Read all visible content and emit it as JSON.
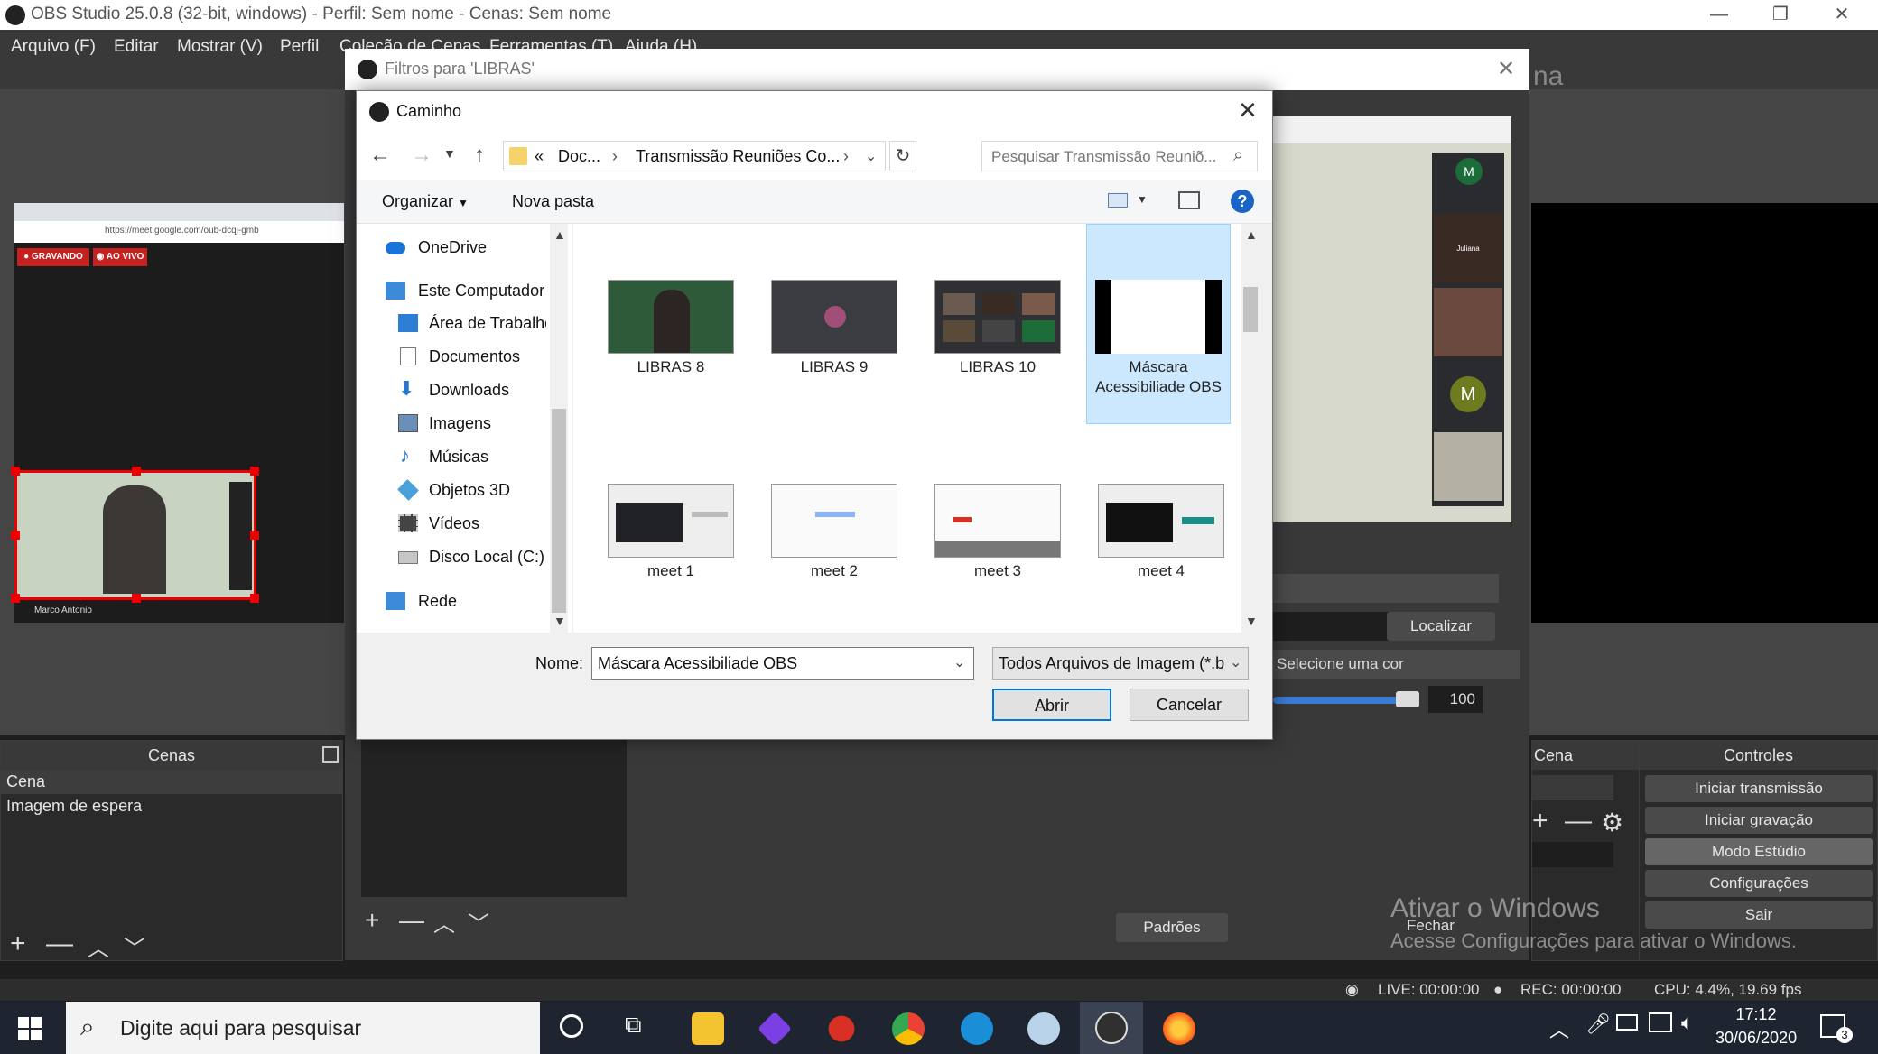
{
  "obs": {
    "window_title": "OBS Studio 25.0.8 (32-bit, windows) - Perfil: Sem nome - Cenas: Sem nome",
    "menu": [
      "Arquivo (F)",
      "Editar",
      "Mostrar (V)",
      "Perfil",
      "Coleção de Cenas",
      "Ferramentas (T)",
      "Ajuda (H)"
    ],
    "window_controls": [
      "—",
      "❐",
      "✕"
    ],
    "scene_name_partial": "na",
    "preview_left": {
      "browser_url": "https://meet.google.com/oub-dcqj-gmb",
      "badge_recording": "GRAVANDO",
      "badge_live": "AO VIVO",
      "participant_name": "Marco Antonio"
    },
    "preview_right": {
      "tile_letters": [
        "M",
        "M"
      ],
      "tile_name": "Juliana"
    },
    "filter_props": {
      "find_button": "Localizar",
      "color_field": "Selecione uma cor",
      "opacity_value": "100",
      "defaults_button": "Padrões",
      "close_button": "Fechar"
    },
    "scenes_dock": {
      "title": "Cenas",
      "items": [
        "Cena",
        "Imagem de espera"
      ]
    },
    "transition_dock": {
      "title_partial": "Cena"
    },
    "controls_dock": {
      "title": "Controles",
      "buttons": [
        "Iniciar transmissão",
        "Iniciar gravação",
        "Modo Estúdio",
        "Configurações",
        "Sair"
      ]
    },
    "status": {
      "live": "LIVE: 00:00:00",
      "rec": "REC: 00:00:00",
      "cpu": "CPU: 4.4%, 19.69 fps"
    },
    "activate_windows": {
      "title": "Ativar o Windows",
      "subtitle": "Acesse Configurações para ativar o Windows."
    }
  },
  "filters_dialog": {
    "title": "Filtros para 'LIBRAS'"
  },
  "file_dialog": {
    "title": "Caminho",
    "breadcrumb": [
      "«",
      "Doc...",
      "Transmissão Reuniões Co..."
    ],
    "search_placeholder": "Pesquisar Transmissão Reuniõ...",
    "toolbar": {
      "organize": "Organizar",
      "new_folder": "Nova pasta"
    },
    "nav": [
      {
        "label": "OneDrive",
        "icon": "cloud-icon"
      },
      {
        "label": "Este Computador",
        "icon": "computer-icon"
      },
      {
        "label": "Área de Trabalho",
        "icon": "desktop-icon"
      },
      {
        "label": "Documentos",
        "icon": "documents-icon"
      },
      {
        "label": "Downloads",
        "icon": "download-icon"
      },
      {
        "label": "Imagens",
        "icon": "images-icon"
      },
      {
        "label": "Músicas",
        "icon": "music-icon"
      },
      {
        "label": "Objetos 3D",
        "icon": "cube-icon"
      },
      {
        "label": "Vídeos",
        "icon": "video-icon"
      },
      {
        "label": "Disco Local (C:)",
        "icon": "disk-icon"
      },
      {
        "label": "Rede",
        "icon": "network-icon"
      }
    ],
    "files": [
      {
        "name": "LIBRAS 8",
        "selected": false
      },
      {
        "name": "LIBRAS 9",
        "selected": false
      },
      {
        "name": "LIBRAS 10",
        "selected": false
      },
      {
        "name": "Máscara Acessibiliade OBS",
        "selected": true
      },
      {
        "name": "meet 1",
        "selected": false
      },
      {
        "name": "meet 2",
        "selected": false
      },
      {
        "name": "meet 3",
        "selected": false
      },
      {
        "name": "meet 4",
        "selected": false
      }
    ],
    "filename_label": "Nome:",
    "filename_value": "Máscara Acessibiliade OBS",
    "filter_type": "Todos Arquivos de Imagem (*.b",
    "open_button": "Abrir",
    "cancel_button": "Cancelar"
  },
  "taskbar": {
    "search_placeholder": "Digite aqui para pesquisar",
    "time": "17:12",
    "date": "30/06/2020",
    "notification_count": "3"
  },
  "colors": {
    "accent": "#0078d7",
    "selection": "#cce8ff",
    "obs_dark": "#2a2a2a",
    "recording_red": "#d93025"
  }
}
